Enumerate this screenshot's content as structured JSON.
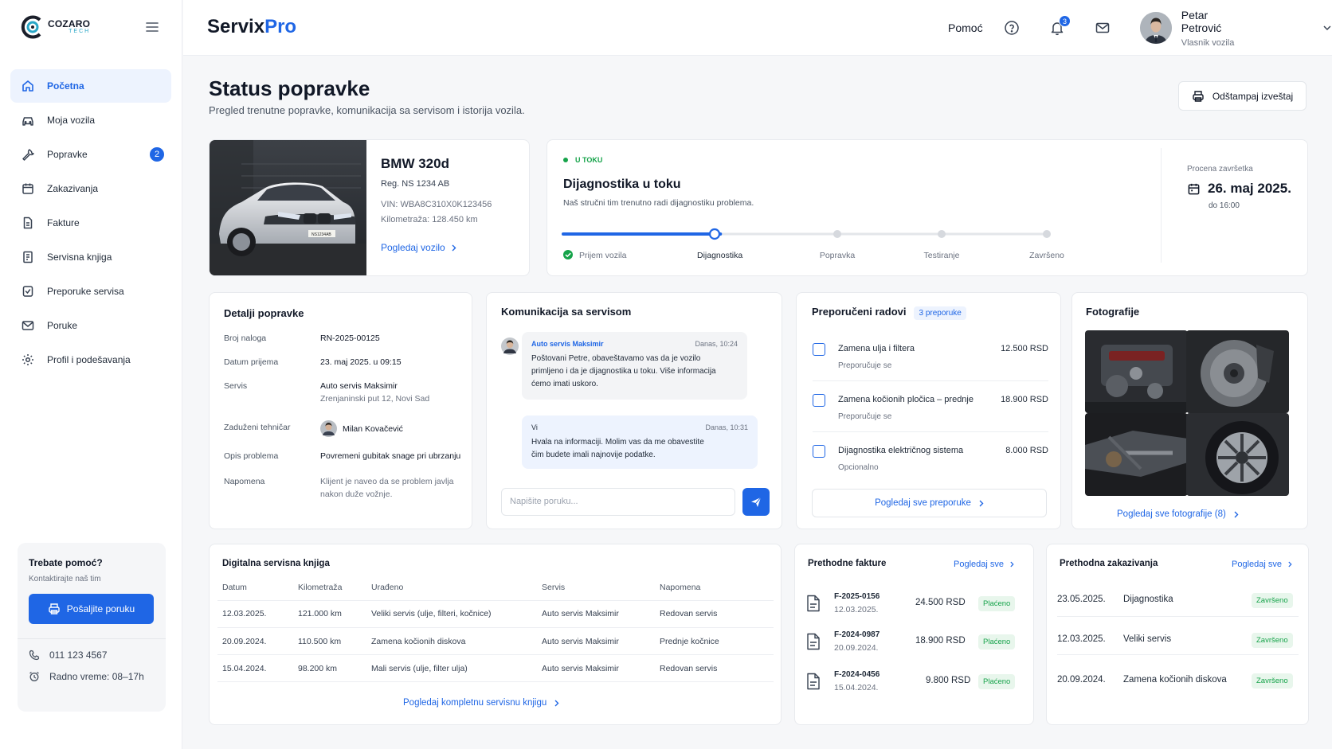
{
  "logo": {
    "line1": "COZARO",
    "line2": "TECH"
  },
  "sidebar": {
    "items": [
      {
        "label": "Početna",
        "icon": "home-icon",
        "active": true
      },
      {
        "label": "Moja vozila",
        "icon": "car-icon"
      },
      {
        "label": "Popravke",
        "icon": "wrench-icon",
        "badge": "2"
      },
      {
        "label": "Zakazivanja",
        "icon": "calendar-icon"
      },
      {
        "label": "Fakture",
        "icon": "invoice-icon"
      },
      {
        "label": "Servisna knjiga",
        "icon": "book-icon"
      },
      {
        "label": "Preporuke servisa",
        "icon": "shield-icon"
      },
      {
        "label": "Poruke",
        "icon": "mail-icon"
      },
      {
        "label": "Profil i podešavanja",
        "icon": "gear-icon"
      }
    ],
    "help": {
      "title": "Trebate pomoć?",
      "subtitle": "Kontaktirajte naš tim",
      "button": "Pošaljite poruku",
      "phone": "011 123 4567",
      "hours": "Radno vreme: 08–17h"
    }
  },
  "header": {
    "brand_a": "Servix",
    "brand_b": "Pro",
    "help": "Pomoć",
    "notifications": "3",
    "user_name": "Petar Petrović",
    "user_role": "Vlasnik vozila"
  },
  "page": {
    "title": "Status popravke",
    "subtitle": "Pregled trenutne popravke, komunikacija sa servisom i istorija vozila.",
    "print_button": "Odštampaj izveštaj"
  },
  "vehicle": {
    "name": "BMW 320d",
    "reg": "Reg. NS 1234 AB",
    "vin": "VIN: WBA8C310X0K123456",
    "km": "Kilometraža: 128.450 km",
    "link": "Pogledaj vozilo",
    "plate": "NS1234AB"
  },
  "status": {
    "tag": "U TOKU",
    "title": "Dijagnostika u toku",
    "desc": "Naš stručni tim trenutno radi dijagnostiku problema.",
    "progress": 0.325,
    "steps": [
      "Prijem vozila",
      "Dijagnostika",
      "Popravka",
      "Testiranje",
      "Završeno"
    ],
    "eta_label": "Procena završetka",
    "eta_date": "26. maj 2025.",
    "eta_time": "do 16:00"
  },
  "details": {
    "title": "Detalji popravke",
    "rows": [
      {
        "label": "Broj naloga",
        "value": "RN-2025-00125"
      },
      {
        "label": "Datum prijema",
        "value": "23. maj 2025. u 09:15"
      },
      {
        "label": "Servis",
        "value": "Auto servis Maksimir",
        "value2": "Zrenjaninski put 12, Novi Sad"
      },
      {
        "label": "Zaduženi tehničar",
        "value": "Milan Kovačević"
      },
      {
        "label": "Opis problema",
        "value": "Povremeni gubitak snage pri ubrzanju"
      },
      {
        "label": "Napomena",
        "value": "Klijent je naveo da se problem javlja",
        "value2": "nakon duže vožnje."
      }
    ]
  },
  "chat": {
    "title": "Komunikacija sa servisom",
    "messages": [
      {
        "from": "Auto servis Maksimir",
        "time": "Danas, 10:24",
        "text": [
          "Poštovani Petre, obaveštavamo vas da je vozilo",
          "primljeno i da je dijagnostika u toku. Više informacija",
          "ćemo imati uskoro."
        ]
      },
      {
        "from": "Vi",
        "time": "Danas, 10:31",
        "text": [
          "Hvala na informaciji. Molim vas da me obavestite",
          "čim budete imali najnovije podatke."
        ]
      }
    ],
    "placeholder": "Napišite poruku..."
  },
  "recommendations": {
    "title": "Preporučeni radovi",
    "count": "3 preporuke",
    "items": [
      {
        "name": "Zamena ulja i filtera",
        "status": "Preporučuje se",
        "price": "12.500 RSD"
      },
      {
        "name": "Zamena kočionih pločica – prednje",
        "status": "Preporučuje se",
        "price": "18.900 RSD"
      },
      {
        "name": "Dijagnostika električnog sistema",
        "status": "Opcionalno",
        "price": "8.000 RSD"
      }
    ],
    "link": "Pogledaj sve preporuke"
  },
  "photos": {
    "title": "Fotografije",
    "link": "Pogledaj sve fotografije (8)"
  },
  "service_book": {
    "title": "Digitalna servisna knjiga",
    "columns": [
      "Datum",
      "Kilometraža",
      "Urađeno",
      "Servis",
      "Napomena"
    ],
    "rows": [
      [
        "12.03.2025.",
        "121.000 km",
        "Veliki servis (ulje, filteri, kočnice)",
        "Auto servis Maksimir",
        "Redovan servis"
      ],
      [
        "20.09.2024.",
        "110.500 km",
        "Zamena kočionih diskova",
        "Auto servis Maksimir",
        "Prednje kočnice"
      ],
      [
        "15.04.2024.",
        "98.200 km",
        "Mali servis (ulje, filter ulja)",
        "Auto servis Maksimir",
        "Redovan servis"
      ]
    ],
    "link": "Pogledaj kompletnu servisnu knjigu"
  },
  "invoices": {
    "title": "Prethodne fakture",
    "link": "Pogledaj sve",
    "items": [
      {
        "no": "F-2025-0156",
        "date": "12.03.2025.",
        "amount": "24.500 RSD",
        "status": "Plaćeno"
      },
      {
        "no": "F-2024-0987",
        "date": "20.09.2024.",
        "amount": "18.900 RSD",
        "status": "Plaćeno"
      },
      {
        "no": "F-2024-0456",
        "date": "15.04.2024.",
        "amount": "9.800 RSD",
        "status": "Plaćeno"
      }
    ]
  },
  "appointments": {
    "title": "Prethodna zakazivanja",
    "link": "Pogledaj sve",
    "items": [
      {
        "date": "23.05.2025.",
        "name": "Dijagnostika",
        "status": "Završeno"
      },
      {
        "date": "12.03.2025.",
        "name": "Veliki servis",
        "status": "Završeno"
      },
      {
        "date": "20.09.2024.",
        "name": "Zamena kočionih diskova",
        "status": "Završeno"
      }
    ]
  },
  "colors": {
    "accent": "#1f66e5",
    "success": "#16a34a"
  }
}
